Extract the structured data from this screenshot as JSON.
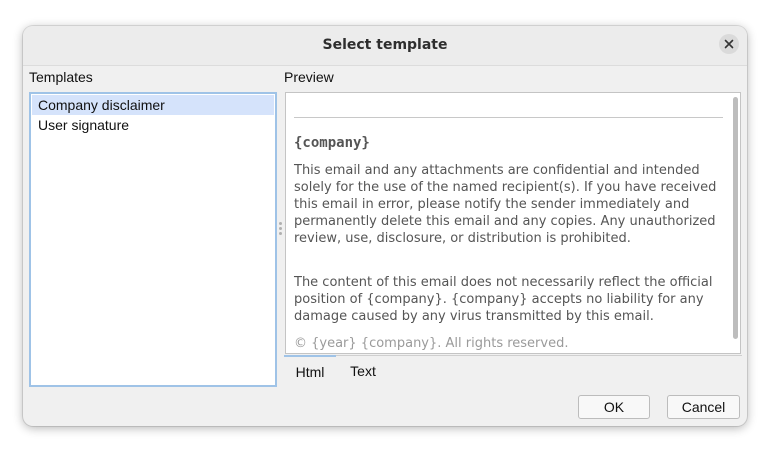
{
  "dialog": {
    "title": "Select template",
    "close_icon": "close-icon"
  },
  "templates": {
    "label": "Templates",
    "items": [
      {
        "label": "Company disclaimer",
        "selected": true
      },
      {
        "label": "User signature",
        "selected": false
      }
    ]
  },
  "preview": {
    "label": "Preview",
    "company_heading": "{company}",
    "paragraph1": "This email and any attachments are confidential and intended solely for the use of the named recipient(s). If you have received this email in error, please notify the sender immediately and permanently delete this email and any copies. Any unauthorized review, use, disclosure, or distribution is prohibited.",
    "paragraph2": "The content of this email does not necessarily reflect the official position of {company}. {company} accepts no liability for any damage caused by any virus transmitted by this email.",
    "footer": "© {year} {company}. All rights reserved."
  },
  "tabs": [
    {
      "label": "Html",
      "active": true
    },
    {
      "label": "Text",
      "active": false
    }
  ],
  "buttons": {
    "ok": "OK",
    "cancel": "Cancel"
  },
  "colors": {
    "selection": "#d5e3fb",
    "focus_border": "#9fc3e7",
    "dialog_bg": "#f0f0f0"
  }
}
